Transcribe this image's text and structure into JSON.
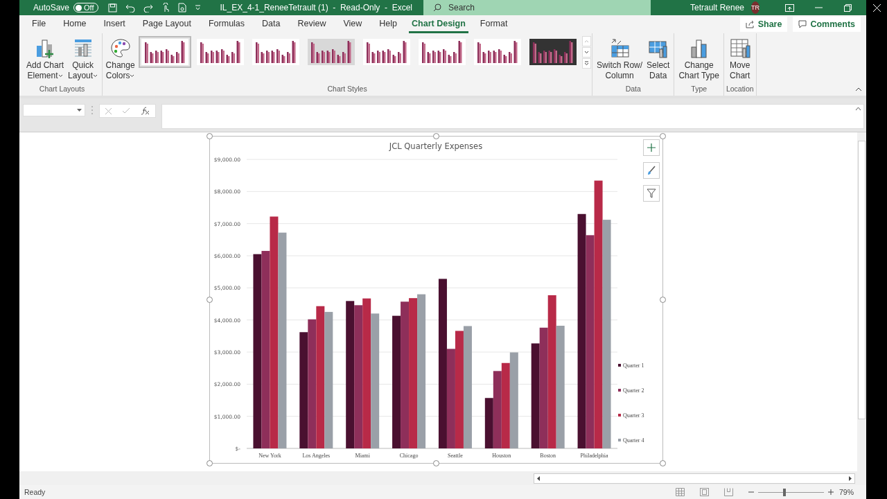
{
  "title_bar": {
    "autosave": {
      "label": "AutoSave",
      "on": false,
      "state_label": "Off"
    },
    "title": "IL_EX_4-1_ReneeTetrault (1)  -  Read-Only  -  Excel",
    "search": {
      "placeholder": "Search"
    },
    "user": "Tetrault Renee",
    "initials": "TR"
  },
  "ribbon": {
    "tabs": [
      {
        "label": "File",
        "selected": false
      },
      {
        "label": "Home",
        "selected": false
      },
      {
        "label": "Insert",
        "selected": false
      },
      {
        "label": "Page Layout",
        "selected": false
      },
      {
        "label": "Formulas",
        "selected": false
      },
      {
        "label": "Data",
        "selected": false
      },
      {
        "label": "Review",
        "selected": false
      },
      {
        "label": "View",
        "selected": false
      },
      {
        "label": "Help",
        "selected": false
      },
      {
        "label": "Chart Design",
        "selected": true
      },
      {
        "label": "Format",
        "selected": false
      }
    ],
    "share": "Share",
    "comments": "Comments",
    "groups": [
      {
        "kind": "buttons",
        "label": "Chart Layouts",
        "buttons": [
          {
            "lines": [
              "Add Chart",
              "Element"
            ],
            "dropdown": true
          },
          {
            "lines": [
              "Quick",
              "Layout"
            ],
            "dropdown": true
          }
        ]
      },
      {
        "kind": "styles",
        "label": "Chart Styles",
        "buttons": [
          {
            "lines": [
              "Change",
              "Colors"
            ],
            "dropdown": true
          }
        ],
        "gallery": [
          {
            "kind": "light",
            "selected": true
          },
          {
            "kind": "light",
            "selected": false
          },
          {
            "kind": "light",
            "selected": false
          },
          {
            "kind": "gray",
            "selected": false
          },
          {
            "kind": "light",
            "selected": false
          },
          {
            "kind": "light",
            "selected": false
          },
          {
            "kind": "light",
            "selected": false
          },
          {
            "kind": "dark",
            "selected": false
          }
        ]
      },
      {
        "kind": "buttons",
        "label": "Data",
        "buttons": [
          {
            "lines": [
              "Switch Row/",
              "Column"
            ],
            "dropdown": false
          },
          {
            "lines": [
              "Select",
              "Data"
            ],
            "dropdown": false
          }
        ]
      },
      {
        "kind": "buttons",
        "label": "Type",
        "buttons": [
          {
            "lines": [
              "Change",
              "Chart Type"
            ],
            "dropdown": false
          }
        ]
      },
      {
        "kind": "buttons",
        "label": "Location",
        "buttons": [
          {
            "lines": [
              "Move",
              "Chart"
            ],
            "dropdown": false
          }
        ]
      }
    ]
  },
  "sheet": {
    "chart": {
      "chart_data": {
        "type": "bar",
        "title": "JCL Quarterly Expenses",
        "categories": [
          "New York",
          "Los Angeles",
          "Miami",
          "Chicago",
          "Seattle",
          "Houston",
          "Boston",
          "Philadelphia"
        ],
        "series": [
          {
            "name": "Quarter 1",
            "color": "#4a1030",
            "values": [
              6050,
              3620,
              4590,
              4130,
              5280,
              1570,
              3270,
              7300
            ]
          },
          {
            "name": "Quarter 2",
            "color": "#8e2f5a",
            "values": [
              6150,
              4020,
              4460,
              4570,
              3100,
              2410,
              3760,
              6640
            ]
          },
          {
            "name": "Quarter 3",
            "color": "#b82a48",
            "values": [
              7220,
              4430,
              4670,
              4680,
              3660,
              2660,
              4770,
              8340
            ]
          },
          {
            "name": "Quarter 4",
            "color": "#9aa0a8",
            "values": [
              6720,
              4250,
              4200,
              4800,
              3810,
              2990,
              3820,
              7120
            ]
          }
        ],
        "ylim": [
          0,
          9000
        ],
        "grid": true,
        "legend": true,
        "yticks": [
          {
            "value": 0,
            "label": "$-"
          },
          {
            "value": 1000,
            "label": "$1,000.00"
          },
          {
            "value": 2000,
            "label": "$2,000.00"
          },
          {
            "value": 3000,
            "label": "$3,000.00"
          },
          {
            "value": 4000,
            "label": "$4,000.00"
          },
          {
            "value": 5000,
            "label": "$5,000.00"
          },
          {
            "value": 6000,
            "label": "$6,000.00"
          },
          {
            "value": 7000,
            "label": "$7,000.00"
          },
          {
            "value": 8000,
            "label": "$8,000.00"
          },
          {
            "value": 9000,
            "label": "$9,000.00"
          }
        ]
      }
    }
  },
  "status_bar": {
    "text": "Ready",
    "zoom": {
      "level": 0.4,
      "label": "79%"
    }
  }
}
